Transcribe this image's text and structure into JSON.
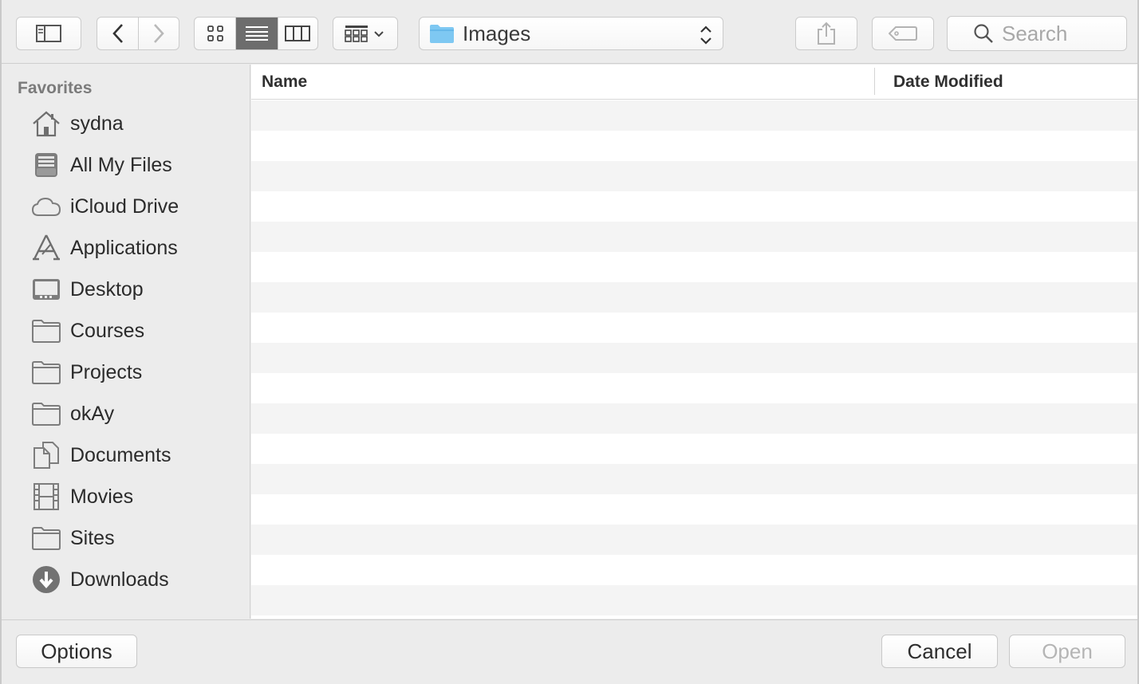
{
  "toolbar": {
    "path_popup": {
      "label": "Images",
      "icon": "folder-icon"
    },
    "search": {
      "placeholder": "Search",
      "icon": "magnifier-icon"
    },
    "view_mode_selected": "list"
  },
  "sidebar": {
    "heading": "Favorites",
    "items": [
      {
        "label": "sydna",
        "icon": "home-icon"
      },
      {
        "label": "All My Files",
        "icon": "all-files-icon"
      },
      {
        "label": "iCloud Drive",
        "icon": "cloud-icon"
      },
      {
        "label": "Applications",
        "icon": "applications-icon"
      },
      {
        "label": "Desktop",
        "icon": "desktop-icon"
      },
      {
        "label": "Courses",
        "icon": "folder-icon"
      },
      {
        "label": "Projects",
        "icon": "folder-icon"
      },
      {
        "label": "okAy",
        "icon": "folder-icon"
      },
      {
        "label": "Documents",
        "icon": "documents-icon"
      },
      {
        "label": "Movies",
        "icon": "film-icon"
      },
      {
        "label": "Sites",
        "icon": "folder-icon"
      },
      {
        "label": "Downloads",
        "icon": "download-icon"
      }
    ]
  },
  "file_list": {
    "columns": [
      "Name",
      "Date Modified"
    ],
    "rows": []
  },
  "footer": {
    "options_label": "Options",
    "cancel_label": "Cancel",
    "open_label": "Open",
    "open_enabled": false
  },
  "colors": {
    "window_bg": "#ececec",
    "selected_segment": "#6d6d6d",
    "stripe": "#f4f4f4",
    "icon_gray": "#7d7d7d",
    "folder_blue": "#7ec8f2"
  }
}
